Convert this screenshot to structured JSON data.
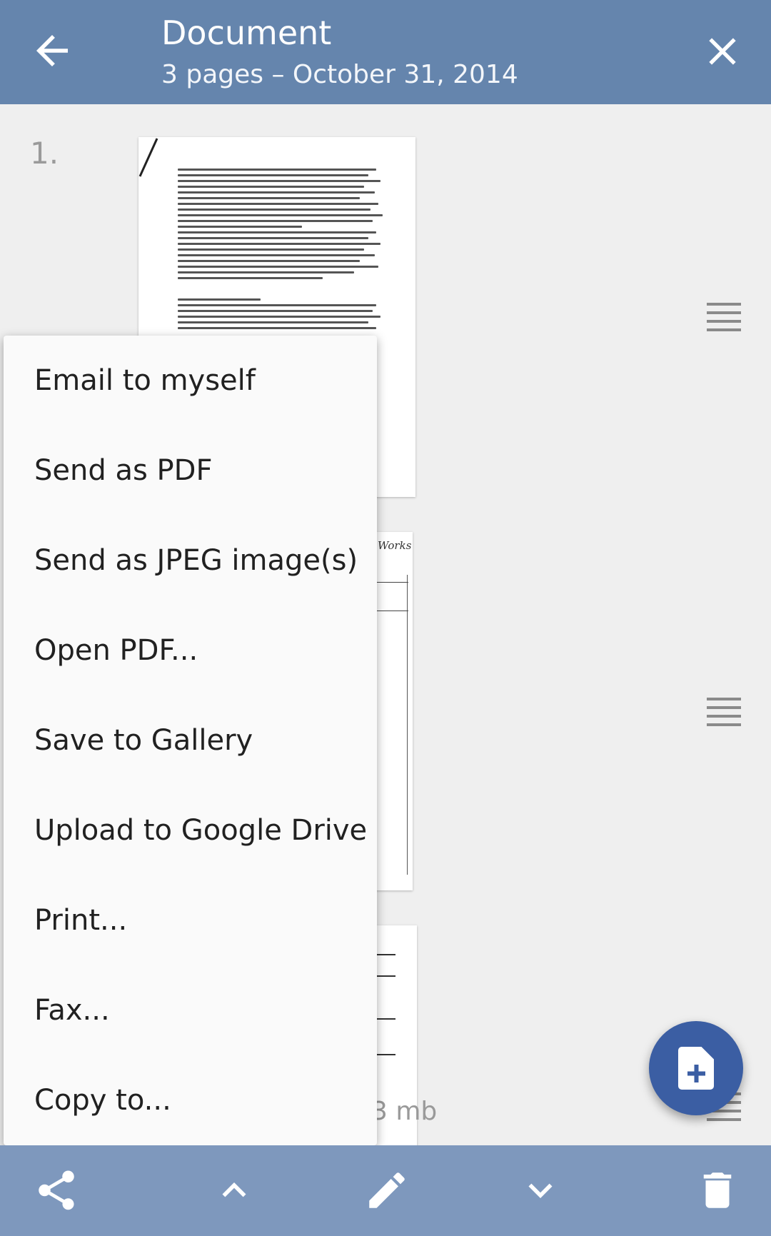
{
  "appbar": {
    "title": "Document",
    "subtitle": "3 pages – October 31, 2014",
    "back_icon": "arrow-back-icon",
    "close_icon": "close-icon",
    "color": "#6585ad"
  },
  "pages": {
    "first_number": "1.",
    "size_label": "3 mb",
    "thumb2_header": "Works"
  },
  "menu": {
    "items": [
      "Email to myself",
      "Send as PDF",
      "Send as JPEG image(s)",
      "Open PDF...",
      "Save to Gallery",
      "Upload to Google Drive",
      "Print...",
      "Fax...",
      "Copy to..."
    ]
  },
  "fab": {
    "icon": "add-document-icon",
    "color": "#3b5ea3"
  },
  "bottombar": {
    "color": "#7e98bd",
    "icons": [
      "share-icon",
      "chevron-up-icon",
      "edit-icon",
      "chevron-down-icon",
      "delete-icon"
    ]
  }
}
